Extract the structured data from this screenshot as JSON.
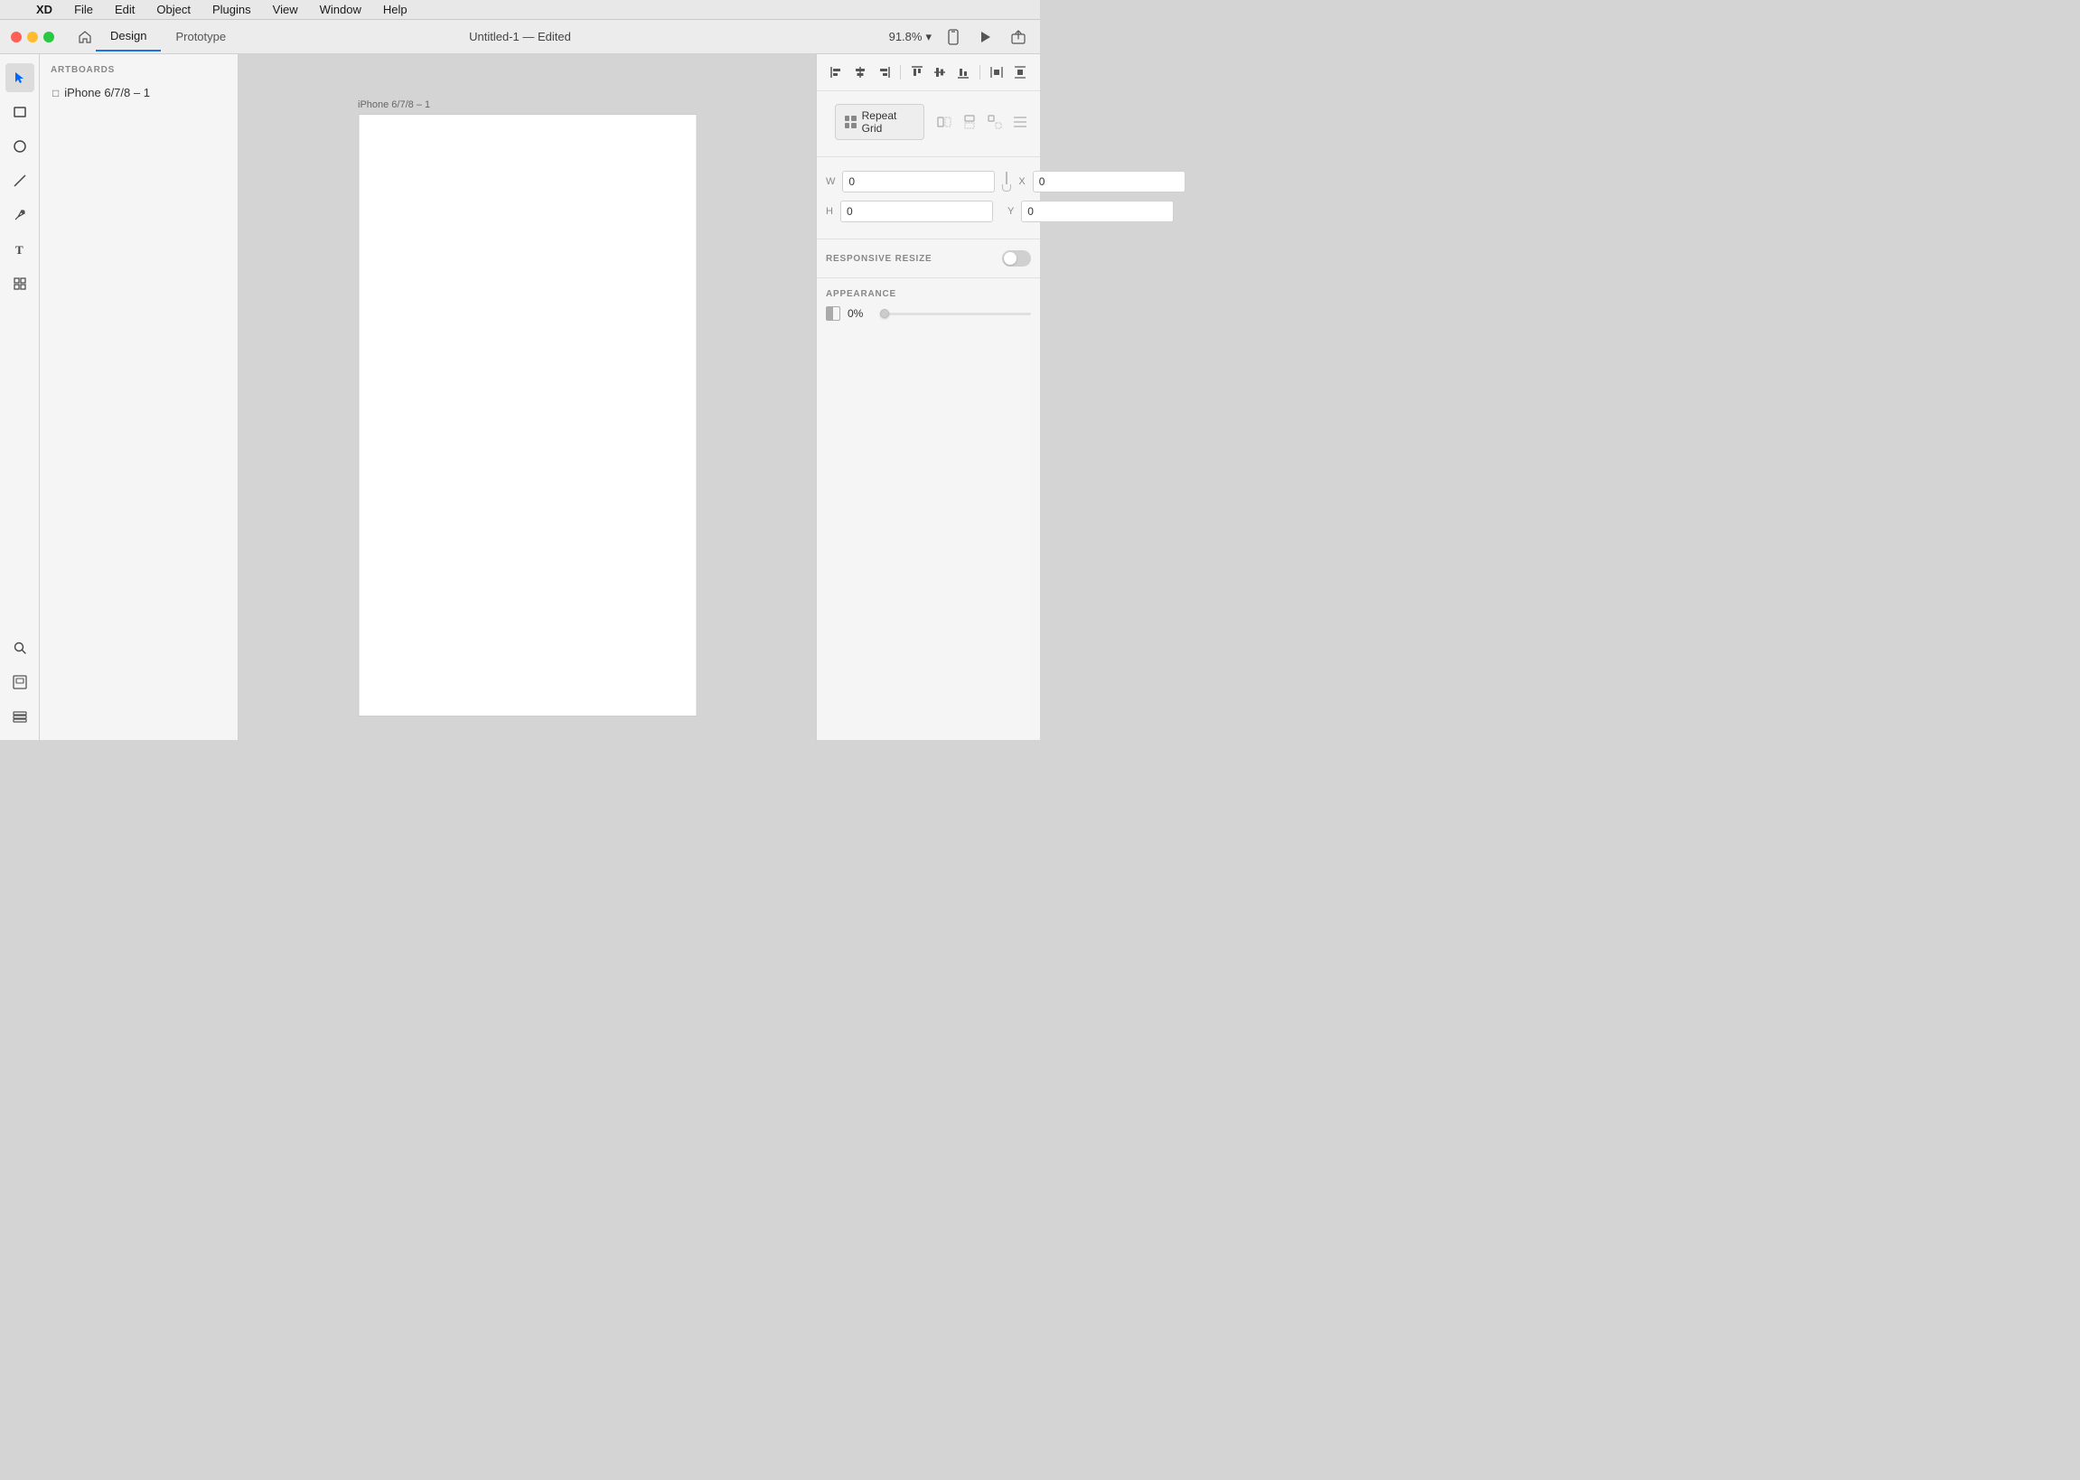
{
  "menubar": {
    "apple": "⌘",
    "items": [
      "XD",
      "File",
      "Edit",
      "Object",
      "Plugins",
      "View",
      "Window",
      "Help"
    ]
  },
  "titlebar": {
    "window_title": "Untitled-1 — Edited",
    "zoom_level": "91.8%",
    "tabs": [
      {
        "label": "Design",
        "active": true
      },
      {
        "label": "Prototype",
        "active": false
      }
    ]
  },
  "left_panel": {
    "section_title": "ARTBOARDS",
    "artboards": [
      {
        "name": "iPhone 6/7/8 – 1"
      }
    ]
  },
  "canvas": {
    "artboard_label": "iPhone 6/7/8 – 1"
  },
  "right_panel": {
    "repeat_grid_label": "Repeat Grid",
    "transform": {
      "w_label": "W",
      "w_value": "0",
      "x_label": "X",
      "x_value": "0",
      "h_label": "H",
      "h_value": "0",
      "y_label": "Y",
      "y_value": "0"
    },
    "responsive_resize": {
      "label": "RESPONSIVE RESIZE"
    },
    "appearance": {
      "label": "APPEARANCE",
      "opacity_value": "0%"
    }
  },
  "toolbar": {
    "tools": [
      {
        "name": "select",
        "icon": "▲",
        "active": true
      },
      {
        "name": "rectangle",
        "icon": "□",
        "active": false
      },
      {
        "name": "ellipse",
        "icon": "○",
        "active": false
      },
      {
        "name": "line",
        "icon": "╱",
        "active": false
      },
      {
        "name": "pen",
        "icon": "✒",
        "active": false
      },
      {
        "name": "text",
        "icon": "T",
        "active": false
      },
      {
        "name": "component",
        "icon": "❑",
        "active": false
      },
      {
        "name": "search",
        "icon": "⌕",
        "active": false
      }
    ],
    "bottom_tools": [
      {
        "name": "artboards",
        "icon": "⊡"
      },
      {
        "name": "layers",
        "icon": "◧"
      }
    ]
  }
}
